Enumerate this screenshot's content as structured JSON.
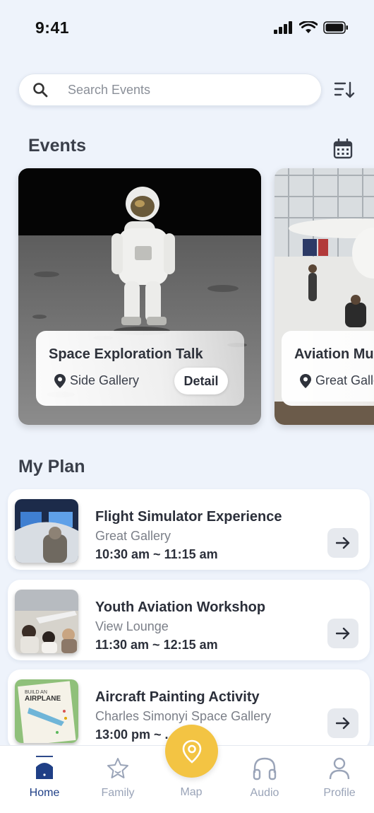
{
  "status": {
    "time": "9:41"
  },
  "search": {
    "placeholder": "Search Events"
  },
  "events": {
    "title": "Events",
    "cards": [
      {
        "title": "Space Exploration Talk",
        "location": "Side Gallery",
        "detail_label": "Detail"
      },
      {
        "title": "Aviation Mu",
        "location": "Great Galle"
      }
    ]
  },
  "plan": {
    "title": "My Plan",
    "items": [
      {
        "name": "Flight Simulator Experience",
        "location": "Great Gallery",
        "time": "10:30 am ~ 11:15 am"
      },
      {
        "name": "Youth Aviation Workshop",
        "location": "View Lounge",
        "time": "11:30 am ~ 12:15 am"
      },
      {
        "name": "Aircraft Painting Activity",
        "location": "Charles Simonyi Space Gallery",
        "time": "13:00 pm ~ ..."
      }
    ]
  },
  "tabs": {
    "home": "Home",
    "family": "Family",
    "map": "Map",
    "audio": "Audio",
    "profile": "Profile"
  },
  "colors": {
    "accent": "#f3c443",
    "active_tab": "#1f3f86",
    "background": "#eef3fb"
  }
}
